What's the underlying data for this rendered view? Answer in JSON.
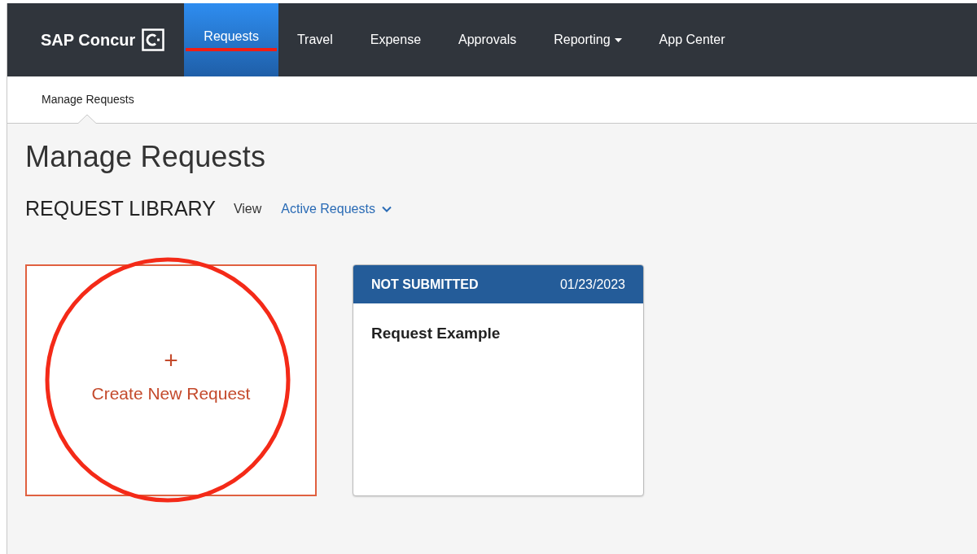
{
  "brand": {
    "name": "SAP Concur"
  },
  "nav": [
    {
      "label": "Requests",
      "selected": true,
      "dropdown": false,
      "annotated": true
    },
    {
      "label": "Travel",
      "selected": false,
      "dropdown": false,
      "annotated": false
    },
    {
      "label": "Expense",
      "selected": false,
      "dropdown": false,
      "annotated": false
    },
    {
      "label": "Approvals",
      "selected": false,
      "dropdown": false,
      "annotated": false
    },
    {
      "label": "Reporting",
      "selected": false,
      "dropdown": true,
      "annotated": false
    },
    {
      "label": "App Center",
      "selected": false,
      "dropdown": false,
      "annotated": false
    }
  ],
  "subnav": [
    {
      "label": "Manage Requests",
      "selected": true
    }
  ],
  "page_title": "Manage Requests",
  "library": {
    "heading": "REQUEST LIBRARY",
    "view_label": "View",
    "view_value": "Active Requests"
  },
  "cards": [
    {
      "kind": "create",
      "icon": "+",
      "label": "Create New Request",
      "annotated": true
    },
    {
      "kind": "request",
      "status": "NOT SUBMITTED",
      "date": "01/23/2023",
      "name": "Request Example",
      "annotated": false
    }
  ]
}
